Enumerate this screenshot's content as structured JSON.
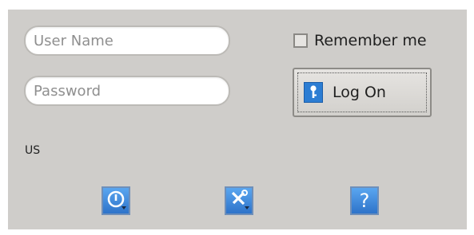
{
  "login": {
    "username_placeholder": "User Name",
    "username_value": "",
    "password_placeholder": "Password",
    "password_value": ""
  },
  "remember": {
    "label": "Remember me",
    "checked": false
  },
  "logon": {
    "label": "Log On",
    "icon": "key-icon"
  },
  "keyboard_layout": "US",
  "toolbar": {
    "buttons": [
      {
        "icon": "power-icon"
      },
      {
        "icon": "tools-icon"
      },
      {
        "icon": "help-icon",
        "label": "?"
      }
    ]
  },
  "colors": {
    "panel": "#cfcdca",
    "accent": "#2e73c9"
  }
}
